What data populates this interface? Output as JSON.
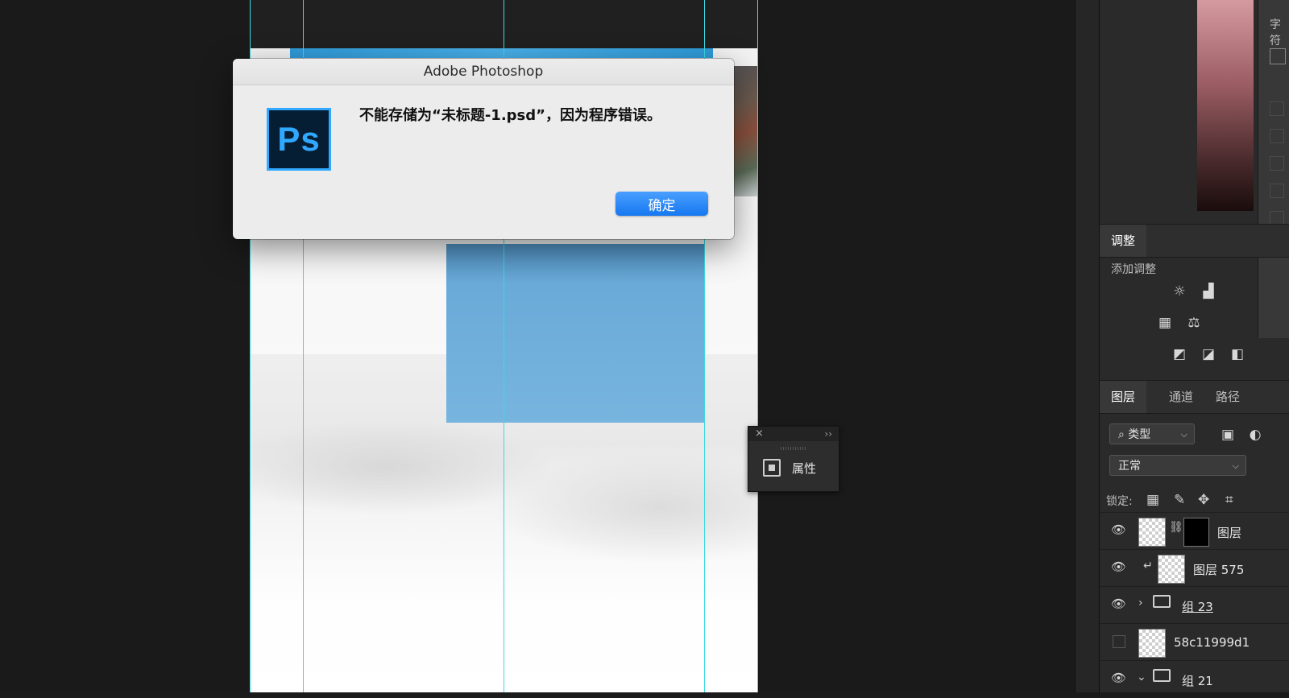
{
  "dialog": {
    "title": "Adobe Photoshop",
    "logo_text": "Ps",
    "message": "不能存储为“未标题-1.psd”，因为程序错误。",
    "ok_label": "确定"
  },
  "mini_panel": {
    "close_glyph": "×",
    "collapse_glyph": "››",
    "label": "属性"
  },
  "panels": {
    "top_tab_partial": "字符",
    "adjustments": {
      "tab": "调整",
      "subtitle": "添加调整",
      "icons": [
        "brightness-icon",
        "levels-icon",
        "channel-mixer-icon",
        "balance-icon",
        "curves-icon",
        "gradient-map-icon",
        "threshold-icon"
      ]
    },
    "layers": {
      "tabs": [
        "图层",
        "通道",
        "路径"
      ],
      "filter_label": "类型",
      "blend_mode": "正常",
      "lock_label": "锁定:",
      "items": [
        {
          "name": "图层",
          "visible": true,
          "type": "masked"
        },
        {
          "name": "图层 575",
          "visible": true,
          "type": "clipped"
        },
        {
          "name": "组 23",
          "visible": true,
          "type": "group"
        },
        {
          "name": "58c11999d1",
          "visible": false,
          "type": "layer"
        },
        {
          "name": "组 21",
          "visible": true,
          "type": "group-open"
        }
      ]
    }
  },
  "colors": {
    "accent": "#1677f0",
    "guide": "#3ed8e4",
    "ps_blue": "#31a8ff",
    "panel_bg": "#2a2a2a"
  }
}
